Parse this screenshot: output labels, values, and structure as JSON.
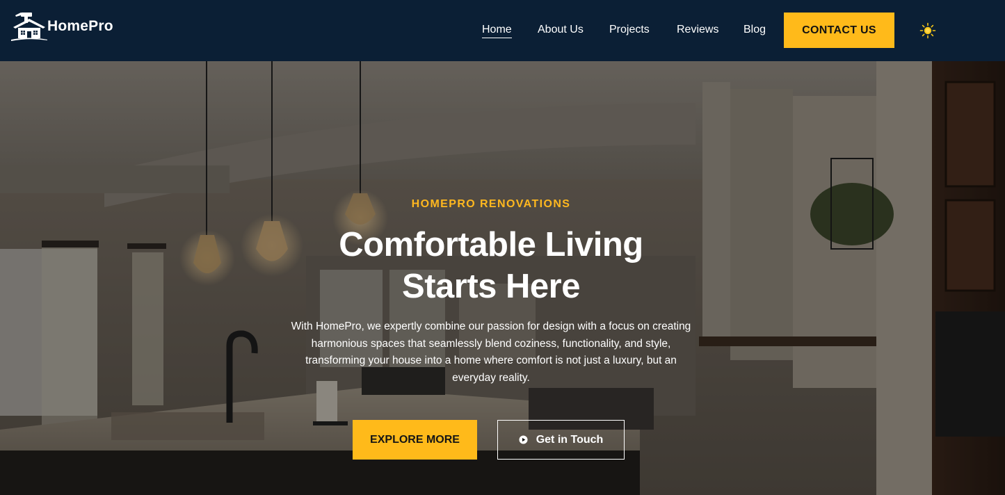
{
  "brand": {
    "name": "HomePro",
    "logo_icon": "house-hammer-icon"
  },
  "nav": {
    "items": [
      {
        "label": "Home",
        "active": true
      },
      {
        "label": "About Us",
        "active": false
      },
      {
        "label": "Projects",
        "active": false
      },
      {
        "label": "Reviews",
        "active": false
      },
      {
        "label": "Blog",
        "active": false
      }
    ],
    "contact_label": "CONTACT US",
    "theme_icon": "sun-icon"
  },
  "hero": {
    "eyebrow": "HOMEPRO RENOVATIONS",
    "title_line1": "Comfortable Living",
    "title_line2": "Starts Here",
    "description": "With HomePro, we expertly combine our passion for design with a focus on creating harmonious spaces that seamlessly blend coziness, functionality, and style, transforming your house into a home where comfort is not just a luxury, but an everyday reality.",
    "primary_cta": "EXPLORE MORE",
    "secondary_cta": "Get in Touch",
    "secondary_icon": "play-circle-icon"
  },
  "colors": {
    "header_bg": "#0b1f35",
    "accent": "#ffba1a",
    "text_light": "#ffffff"
  }
}
